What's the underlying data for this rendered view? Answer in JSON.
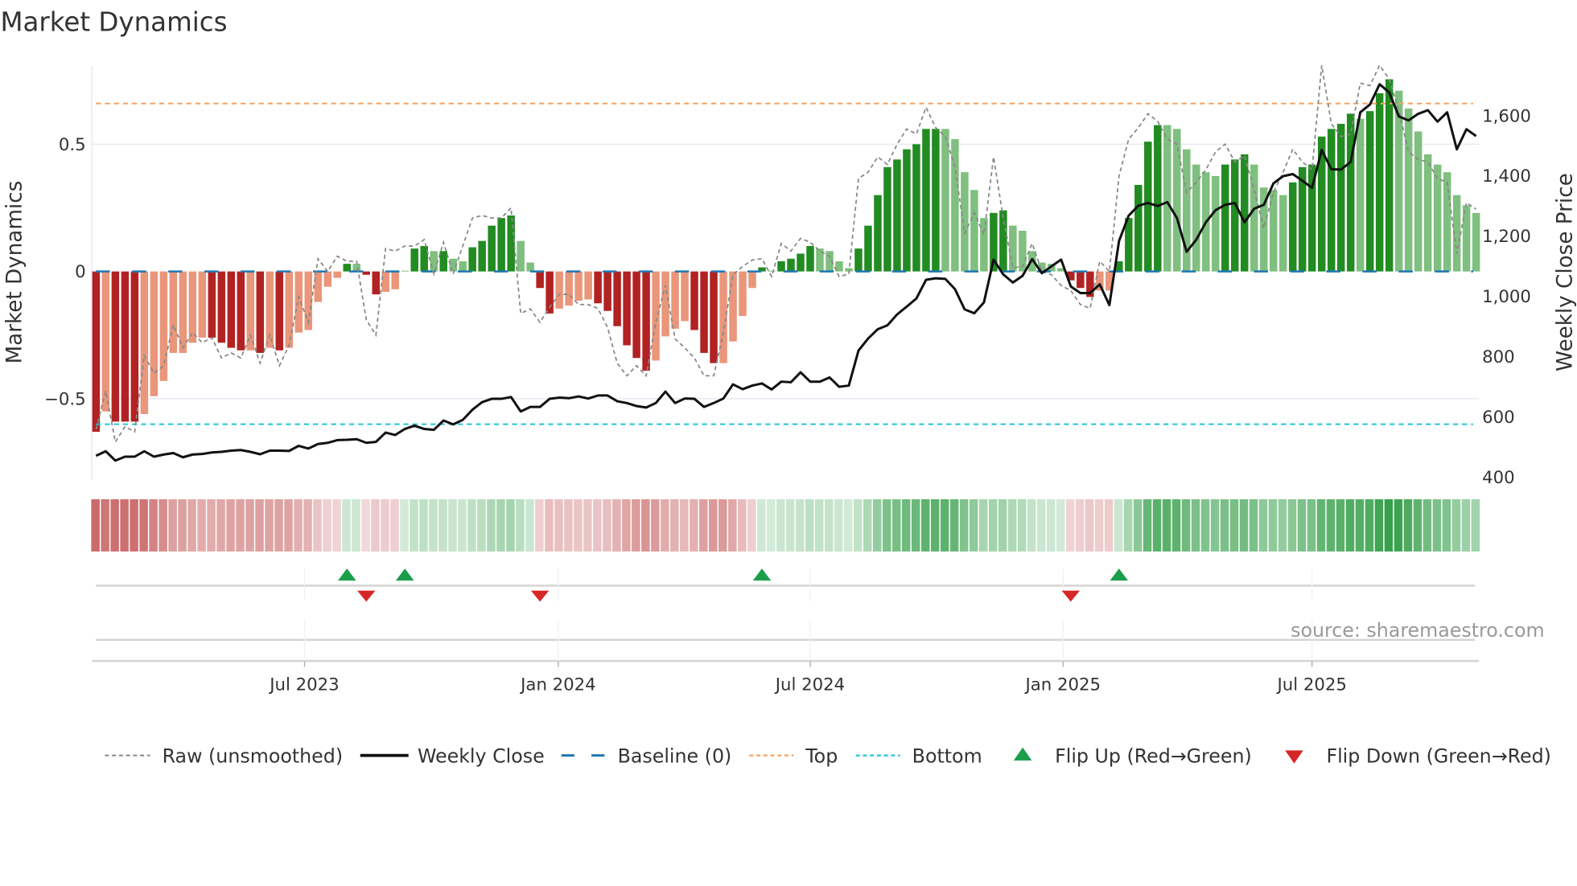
{
  "chart_data": {
    "type": "bar",
    "title": "Market Dynamics",
    "ylabel": "Market Dynamics",
    "y2label": "Weekly Close Price",
    "source": "source: sharemaestro.com",
    "ylim": [
      -0.82,
      0.81
    ],
    "y2lim": [
      390,
      1767
    ],
    "yticks": [
      {
        "value": 0.5,
        "label": "0.5"
      },
      {
        "value": 0,
        "label": "0"
      },
      {
        "value": -0.5,
        "label": "−0.5"
      }
    ],
    "y2ticks": [
      {
        "value": 1600,
        "label": "1,600"
      },
      {
        "value": 1400,
        "label": "1,400"
      },
      {
        "value": 1200,
        "label": "1,200"
      },
      {
        "value": 1000,
        "label": "1,000"
      },
      {
        "value": 800,
        "label": "800"
      },
      {
        "value": 600,
        "label": "600"
      },
      {
        "value": 400,
        "label": "400"
      }
    ],
    "xticks": [
      {
        "week": 22.6,
        "label": "Jul 2023"
      },
      {
        "week": 48.9,
        "label": "Jan 2024"
      },
      {
        "week": 75.0,
        "label": "Jul 2024"
      },
      {
        "week": 101.2,
        "label": "Jan 2025"
      },
      {
        "week": 127.0,
        "label": "Jul 2025"
      }
    ],
    "top_level": 0.66,
    "bottom_level": -0.6,
    "baseline": 0,
    "dynamics": [
      -0.63,
      -0.55,
      -0.59,
      -0.59,
      -0.59,
      -0.56,
      -0.49,
      -0.43,
      -0.32,
      -0.32,
      -0.28,
      -0.26,
      -0.26,
      -0.28,
      -0.3,
      -0.31,
      -0.31,
      -0.32,
      -0.3,
      -0.31,
      -0.3,
      -0.24,
      -0.23,
      -0.12,
      -0.06,
      -0.025,
      0.03,
      0.03,
      -0.013,
      -0.09,
      -0.08,
      -0.07,
      0.003,
      0.09,
      0.1,
      0.08,
      0.08,
      0.05,
      0.04,
      0.095,
      0.12,
      0.18,
      0.21,
      0.22,
      0.12,
      0.035,
      -0.065,
      -0.165,
      -0.146,
      -0.134,
      -0.115,
      -0.11,
      -0.125,
      -0.155,
      -0.215,
      -0.29,
      -0.34,
      -0.39,
      -0.35,
      -0.255,
      -0.225,
      -0.195,
      -0.23,
      -0.32,
      -0.36,
      -0.36,
      -0.275,
      -0.175,
      -0.065,
      0.016,
      0.003,
      0.04,
      0.05,
      0.07,
      0.1,
      0.09,
      0.08,
      0.04,
      0.013,
      0.09,
      0.18,
      0.3,
      0.41,
      0.44,
      0.48,
      0.5,
      0.56,
      0.56,
      0.56,
      0.52,
      0.39,
      0.32,
      0.21,
      0.23,
      0.24,
      0.18,
      0.16,
      0.08,
      0.035,
      0.03,
      0.013,
      -0.035,
      -0.065,
      -0.1,
      -0.075,
      -0.075,
      0.04,
      0.21,
      0.34,
      0.51,
      0.575,
      0.575,
      0.56,
      0.48,
      0.42,
      0.39,
      0.375,
      0.42,
      0.44,
      0.46,
      0.42,
      0.33,
      0.32,
      0.3,
      0.35,
      0.41,
      0.42,
      0.53,
      0.56,
      0.58,
      0.62,
      0.6,
      0.63,
      0.7,
      0.755,
      0.71,
      0.64,
      0.55,
      0.46,
      0.42,
      0.39,
      0.3,
      0.26,
      0.23
    ],
    "strong": [
      1,
      0,
      1,
      1,
      1,
      0,
      0,
      0,
      0,
      0,
      0,
      0,
      1,
      1,
      1,
      1,
      0,
      1,
      0,
      1,
      0,
      0,
      0,
      0,
      0,
      0,
      1,
      0,
      1,
      1,
      0,
      0,
      0,
      1,
      1,
      0,
      1,
      0,
      0,
      1,
      1,
      1,
      1,
      1,
      0,
      0,
      1,
      1,
      0,
      0,
      0,
      0,
      1,
      1,
      1,
      1,
      1,
      1,
      0,
      0,
      0,
      0,
      1,
      1,
      1,
      0,
      0,
      0,
      0,
      1,
      0,
      1,
      1,
      1,
      1,
      0,
      0,
      0,
      0,
      1,
      1,
      1,
      1,
      1,
      1,
      1,
      1,
      1,
      0,
      0,
      0,
      0,
      0,
      1,
      1,
      0,
      0,
      0,
      0,
      0,
      0,
      1,
      1,
      1,
      0,
      0,
      1,
      1,
      1,
      1,
      1,
      0,
      0,
      0,
      0,
      0,
      0,
      1,
      1,
      1,
      0,
      0,
      0,
      0,
      1,
      1,
      1,
      1,
      1,
      1,
      1,
      0,
      1,
      1,
      1,
      0,
      0,
      0,
      0,
      0,
      0,
      0,
      0,
      0
    ],
    "raw": [
      -0.62,
      -0.47,
      -0.67,
      -0.61,
      -0.63,
      -0.33,
      -0.4,
      -0.37,
      -0.21,
      -0.3,
      -0.24,
      -0.28,
      -0.26,
      -0.34,
      -0.32,
      -0.34,
      -0.25,
      -0.36,
      -0.25,
      -0.37,
      -0.29,
      -0.1,
      -0.2,
      0.05,
      0,
      0.06,
      0.04,
      0.04,
      -0.19,
      -0.25,
      0.09,
      0.08,
      0.1,
      0.1,
      0.125,
      -0.01,
      0.115,
      -0.01,
      0.1,
      0.21,
      0.22,
      0.21,
      0.21,
      0.25,
      -0.165,
      -0.147,
      -0.2,
      -0.14,
      -0.09,
      -0.09,
      -0.13,
      -0.13,
      -0.145,
      -0.22,
      -0.36,
      -0.41,
      -0.37,
      -0.41,
      -0.2,
      -0.055,
      -0.265,
      -0.3,
      -0.34,
      -0.41,
      -0.41,
      -0.24,
      -0.013,
      0.02,
      0.045,
      0.05,
      -0.02,
      0.11,
      0.08,
      0.13,
      0.115,
      0.08,
      0.06,
      -0.02,
      -0.01,
      0.365,
      0.39,
      0.45,
      0.42,
      0.5,
      0.56,
      0.54,
      0.645,
      0.565,
      0.53,
      0.41,
      0.15,
      0.23,
      0.145,
      0.45,
      0.21,
      0.014,
      0.02,
      0.11,
      0,
      -0.013,
      -0.055,
      -0.075,
      -0.13,
      -0.145,
      0.04,
      0,
      0.375,
      0.52,
      0.565,
      0.62,
      0.59,
      0.52,
      0.5,
      0.31,
      0.35,
      0.4,
      0.47,
      0.5,
      0.43,
      0.455,
      0.32,
      0.17,
      0.31,
      0.39,
      0.48,
      0.43,
      0.4,
      0.81,
      0.58,
      0.53,
      0.54,
      0.74,
      0.73,
      0.81,
      0.755,
      0.63,
      0.47,
      0.44,
      0.43,
      0.365,
      0.35,
      0.07,
      0.27,
      0.245
    ],
    "close": [
      471,
      486,
      455,
      468,
      468,
      486,
      468,
      475,
      480,
      466,
      475,
      477,
      482,
      484,
      488,
      490,
      484,
      476,
      488,
      488,
      487,
      504,
      495,
      510,
      514,
      523,
      524,
      526,
      514,
      517,
      548,
      540,
      560,
      571,
      560,
      557,
      588,
      575,
      590,
      624,
      649,
      660,
      660,
      666,
      618,
      633,
      633,
      660,
      664,
      662,
      668,
      661,
      671,
      671,
      652,
      646,
      636,
      631,
      646,
      684,
      646,
      661,
      660,
      633,
      646,
      661,
      708,
      692,
      704,
      711,
      691,
      717,
      715,
      748,
      717,
      717,
      731,
      700,
      704,
      820,
      860,
      891,
      904,
      940,
      966,
      993,
      1055,
      1060,
      1058,
      1024,
      957,
      944,
      980,
      1122,
      1073,
      1046,
      1068,
      1124,
      1077,
      1100,
      1122,
      1033,
      1011,
      1011,
      1040,
      971,
      1184,
      1268,
      1301,
      1310,
      1300,
      1313,
      1260,
      1148,
      1188,
      1246,
      1286,
      1304,
      1310,
      1246,
      1291,
      1304,
      1375,
      1399,
      1406,
      1384,
      1360,
      1486,
      1422,
      1421,
      1446,
      1611,
      1637,
      1704,
      1677,
      1597,
      1584,
      1606,
      1618,
      1580,
      1611,
      1488,
      1555,
      1532
    ],
    "flips_up": [
      27,
      33,
      70,
      107
    ],
    "flips_down": [
      29,
      47,
      102
    ],
    "legend": [
      {
        "key": "raw",
        "label": "Raw (unsmoothed)"
      },
      {
        "key": "close",
        "label": "Weekly Close"
      },
      {
        "key": "baseline",
        "label": "Baseline (0)"
      },
      {
        "key": "top",
        "label": "Top"
      },
      {
        "key": "bottom",
        "label": "Bottom"
      },
      {
        "key": "flip_up",
        "label": "Flip Up (Red→Green)"
      },
      {
        "key": "flip_down",
        "label": "Flip Down (Green→Red)"
      }
    ],
    "legend_position": "bottom",
    "colors": {
      "neg_strong": "#b22222",
      "neg_weak": "#e9967a",
      "pos_strong": "#228b22",
      "pos_weak": "#7fbf7f",
      "raw": "#888888",
      "close": "#111111",
      "baseline": "#1f77b4",
      "top": "#f4a261",
      "bottom": "#22c4d6",
      "flip_up": "#1a9e4a",
      "flip_down": "#d62728"
    }
  }
}
